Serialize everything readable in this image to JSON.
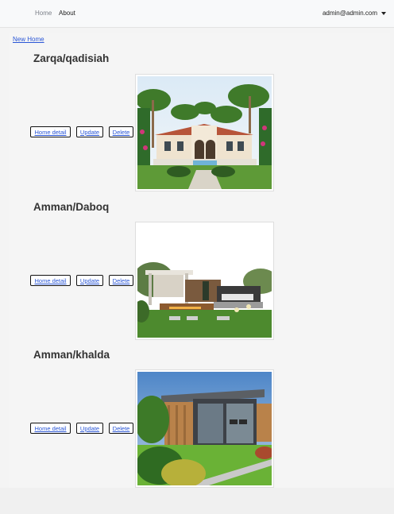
{
  "nav": {
    "home": "Home",
    "about": "About",
    "user": "admin@admin.com"
  },
  "page": {
    "new_home": "New Home"
  },
  "listings": [
    {
      "title": "Zarqa/qadisiah",
      "detail": "Home detail",
      "update": "Update",
      "delete": "Delete",
      "image": "villa-garden-photo"
    },
    {
      "title": "Amman/Daboq",
      "detail": "Home detail",
      "update": "Update",
      "delete": "Delete",
      "image": "garden-lounge-photo"
    },
    {
      "title": "Amman/khalda",
      "detail": "Home detail",
      "update": "Update",
      "delete": "Delete",
      "image": "modern-cabin-photo"
    }
  ],
  "colors": {
    "link": "#2a56d6",
    "navbar": "#f8f9fa",
    "page": "#f5f5f5"
  }
}
